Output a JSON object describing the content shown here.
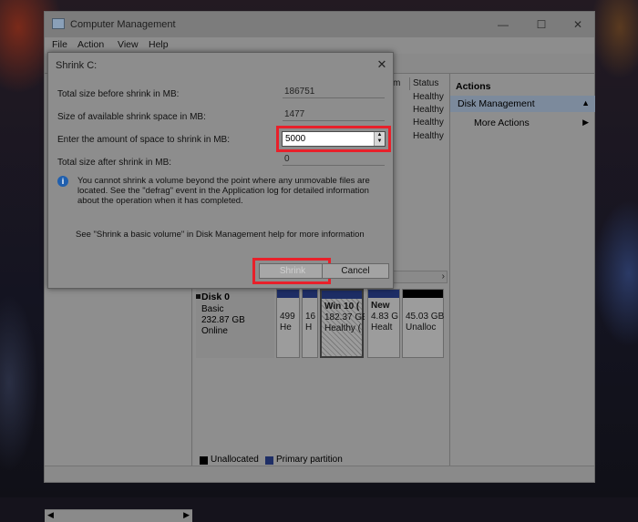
{
  "window": {
    "title": "Computer Management",
    "menu": [
      "File",
      "Action",
      "View",
      "Help"
    ]
  },
  "volume_list": {
    "col_m": "m",
    "col_status": "Status",
    "statuses": [
      "Healthy",
      "Healthy",
      "Healthy",
      "Healthy"
    ]
  },
  "disk": {
    "name": "Disk 0",
    "type": "Basic",
    "size": "232.87 GB",
    "state": "Online",
    "partitions": [
      {
        "line1": "",
        "line2": "499",
        "line3": "He"
      },
      {
        "line1": "",
        "line2": "16",
        "line3": "H"
      },
      {
        "line1": "Win 10 (",
        "line2": "182.37 GB",
        "line3": "Healthy ("
      },
      {
        "line1": "New",
        "line2": "4.83 G",
        "line3": "Healt"
      },
      {
        "line1": "",
        "line2": "45.03 GB",
        "line3": "Unalloc"
      }
    ]
  },
  "legend": {
    "unallocated": "Unallocated",
    "primary": "Primary partition"
  },
  "actions": {
    "title": "Actions",
    "section": "Disk Management",
    "more": "More Actions"
  },
  "dialog": {
    "title": "Shrink C:",
    "rows": [
      {
        "label": "Total size before shrink in MB:",
        "value": "186751"
      },
      {
        "label": "Size of available shrink space in MB:",
        "value": "1477"
      },
      {
        "label": "Enter the amount of space to shrink in MB:",
        "value": "5000"
      },
      {
        "label": "Total size after shrink in MB:",
        "value": "0"
      }
    ],
    "info": "You cannot shrink a volume beyond the point where any unmovable files are located. See the \"defrag\" event in the Application log for detailed information about the operation when it has completed.",
    "help": "See \"Shrink a basic volume\" in Disk Management help for more information",
    "shrink_label": "Shrink",
    "cancel_label": "Cancel"
  },
  "colors": {
    "highlight": "#e8202a",
    "primary_partition": "#1e2e66",
    "unallocated": "#000000"
  }
}
